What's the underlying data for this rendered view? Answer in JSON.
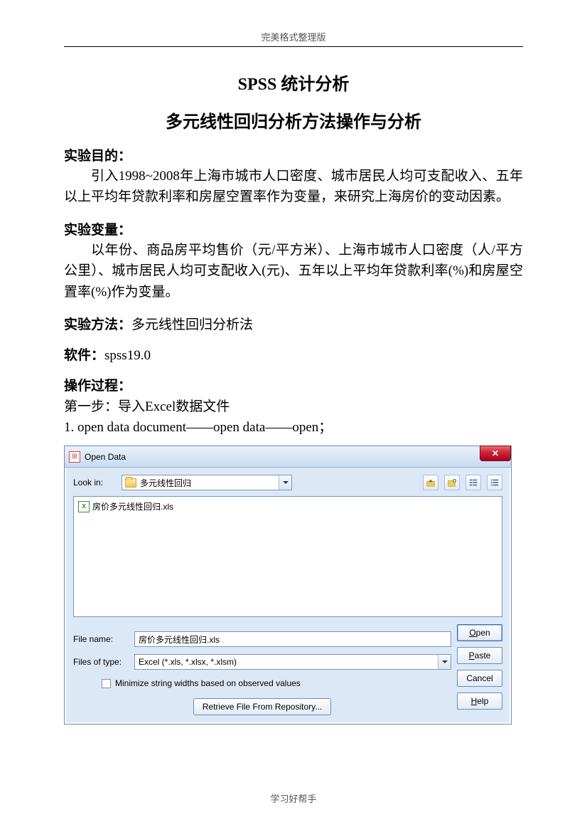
{
  "header": "完美格式整理版",
  "footer": "学习好帮手",
  "title1": "SPSS  统计分析",
  "title2": "多元线性回归分析方法操作与分析",
  "sec_objective": {
    "label": "实验目的：",
    "text": "引入1998~2008年上海市城市人口密度、城市居民人均可支配收入、五年以上平均年贷款利率和房屋空置率作为变量，来研究上海房价的变动因素。"
  },
  "sec_vars": {
    "label": "实验变量：",
    "text": "以年份、商品房平均售价（元/平方米）、上海市城市人口密度（人/平方公里）、城市居民人均可支配收入(元)、五年以上平均年贷款利率(%)和房屋空置率(%)作为变量。"
  },
  "sec_method": {
    "label": "实验方法：",
    "text": "多元线性回归分析法"
  },
  "sec_software": {
    "label": "软件：",
    "text": "spss19.0"
  },
  "sec_process": {
    "label": "操作过程：",
    "step1": "第一步：导入Excel数据文件",
    "step1_detail": "1.  open data document——open data——open；"
  },
  "dialog": {
    "title": "Open Data",
    "lookin_label": "Look in:",
    "lookin_value": "多元线性回归",
    "file_item": "房价多元线性回归.xls",
    "filename_label": "File name:",
    "filename_value": "房价多元线性回归.xls",
    "filetype_label": "Files of type:",
    "filetype_value": "Excel (*.xls, *.xlsx, *.xlsm)",
    "minimize_label": "Minimize string widths based on observed values",
    "retrieve_label": "Retrieve File From Repository...",
    "buttons": {
      "open": {
        "pre": "O",
        "rest": "pen"
      },
      "paste": {
        "pre": "P",
        "rest": "aste"
      },
      "cancel": "Cancel",
      "help": {
        "pre": "H",
        "rest": "elp"
      }
    }
  }
}
